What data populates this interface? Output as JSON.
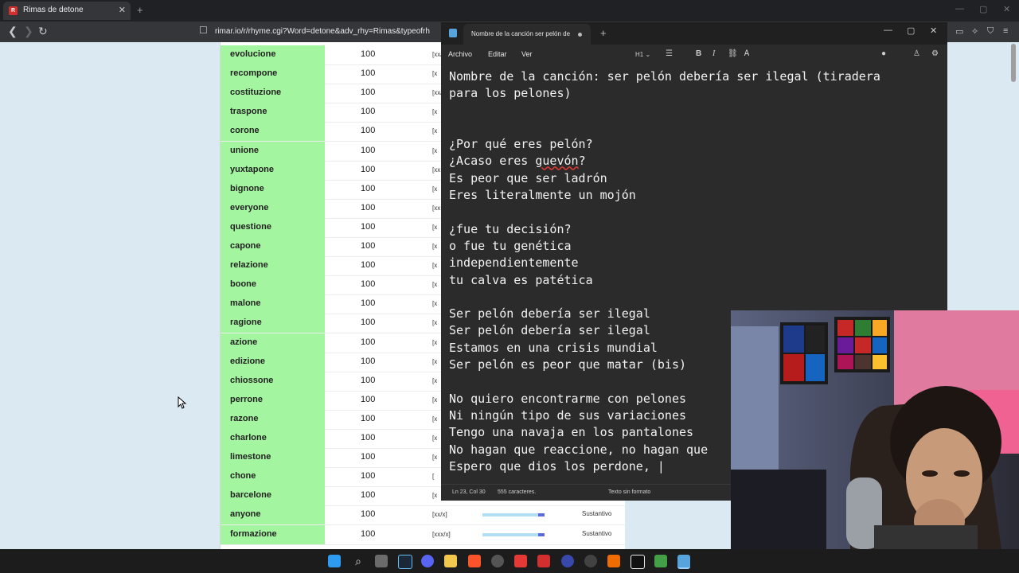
{
  "browser": {
    "tab_title": "Rimas de detone",
    "tab_close": "✕",
    "new_tab": "+",
    "url": "rimar.io/r/rhyme.cgi?Word=detone&adv_rhy=Rimas&typeofrh"
  },
  "rhymes": [
    {
      "word": "evolucione",
      "score": "100",
      "syl": "[xx/x]"
    },
    {
      "word": "recompone",
      "score": "100",
      "syl": "[x"
    },
    {
      "word": "costituzione",
      "score": "100",
      "syl": "[xx/"
    },
    {
      "word": "traspone",
      "score": "100",
      "syl": "[x"
    },
    {
      "word": "corone",
      "score": "100",
      "syl": "[x"
    },
    {
      "word": "unione",
      "score": "100",
      "syl": "[x"
    },
    {
      "word": "yuxtapone",
      "score": "100",
      "syl": "[xx"
    },
    {
      "word": "bignone",
      "score": "100",
      "syl": "[x"
    },
    {
      "word": "everyone",
      "score": "100",
      "syl": "[xx"
    },
    {
      "word": "questione",
      "score": "100",
      "syl": "[x"
    },
    {
      "word": "capone",
      "score": "100",
      "syl": "[x"
    },
    {
      "word": "relazione",
      "score": "100",
      "syl": "[x"
    },
    {
      "word": "boone",
      "score": "100",
      "syl": "[x"
    },
    {
      "word": "malone",
      "score": "100",
      "syl": "[x"
    },
    {
      "word": "ragione",
      "score": "100",
      "syl": "[x"
    },
    {
      "word": "azione",
      "score": "100",
      "syl": "[x"
    },
    {
      "word": "edizione",
      "score": "100",
      "syl": "[x"
    },
    {
      "word": "chiossone",
      "score": "100",
      "syl": "[x"
    },
    {
      "word": "perrone",
      "score": "100",
      "syl": "[x"
    },
    {
      "word": "razone",
      "score": "100",
      "syl": "[x"
    },
    {
      "word": "charlone",
      "score": "100",
      "syl": "[x"
    },
    {
      "word": "limestone",
      "score": "100",
      "syl": "[x"
    },
    {
      "word": "chone",
      "score": "100",
      "syl": "["
    },
    {
      "word": "barcelone",
      "score": "100",
      "syl": "[x"
    },
    {
      "word": "anyone",
      "score": "100",
      "syl": "[xx/x]",
      "type": "Sustantivo"
    },
    {
      "word": "formazione",
      "score": "100",
      "syl": "[xxx/x]",
      "type": "Sustantivo"
    }
  ],
  "notepad": {
    "tab_title": "Nombre de la canción ser pelón de",
    "menu": {
      "file": "Archivo",
      "edit": "Editar",
      "view": "Ver"
    },
    "heading_select": "H1",
    "bold": "B",
    "italic": "I",
    "lines": [
      "Nombre de la canción: ser pelón debería ser ilegal (tiradera",
      "para los pelones)",
      "",
      "",
      "¿Por qué eres pelón?",
      "¿Acaso eres guevón?",
      "Es peor que ser ladrón",
      "Eres literalmente un mojón",
      "",
      "¿fue tu decisión?",
      "o fue tu genética",
      "independientemente",
      "tu calva es patética",
      "",
      "Ser pelón debería ser ilegal",
      "Ser pelón debería ser ilegal",
      "Estamos en una crisis mundial",
      "Ser pelón es peor que matar (bis)",
      "",
      "No quiero encontrarme con pelones",
      "Ni ningún tipo de sus variaciones",
      "Tengo una navaja en los pantalones",
      "No hagan que reaccione, no hagan que",
      "Espero que dios los perdone, |"
    ],
    "status": {
      "position": "Ln 23, Col 30",
      "chars": "555 caracteres.",
      "format": "Texto sin formato"
    }
  },
  "colors": {
    "word_cell": "#a4f5a0",
    "notepad_bg": "#2b2b2b",
    "page_bg": "#dbe9f3"
  }
}
